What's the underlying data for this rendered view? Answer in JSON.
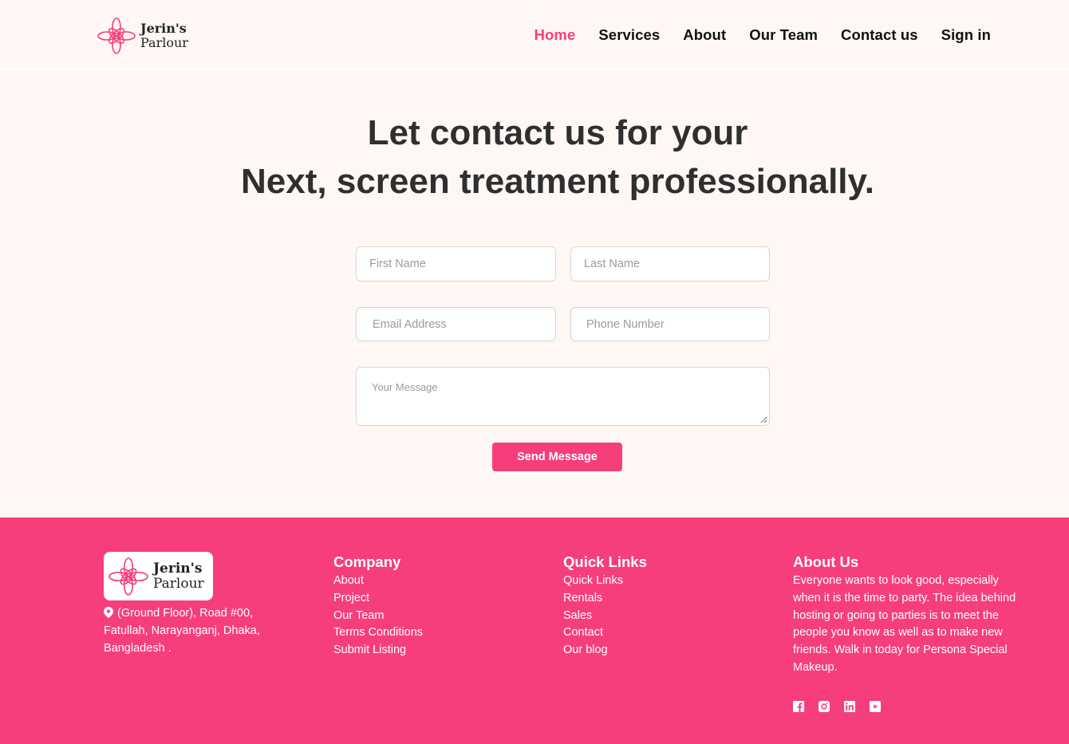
{
  "brand": {
    "name_line1": "Jerin's",
    "name_line2": "Parlour",
    "accent_color": "#f63e7b"
  },
  "nav": {
    "items": [
      "Home",
      "Services",
      "About",
      "Our Team",
      "Contact us",
      "Sign in"
    ],
    "active": "Home"
  },
  "hero": {
    "line1": "Let contact us for your",
    "line2": "Next, screen treatment professionally."
  },
  "form": {
    "first_name_placeholder": "First Name",
    "last_name_placeholder": "Last Name",
    "email_placeholder": "Email Address",
    "phone_placeholder": "Phone Number",
    "message_placeholder": "Your Message",
    "submit_label": "Send Message"
  },
  "footer": {
    "address": "(Ground Floor), Road #00, Fatullah, Narayanganj, Dhaka, Bangladesh .",
    "company": {
      "title": "Company",
      "links": [
        "About",
        "Project",
        "Our Team",
        "Terms Conditions",
        "Submit Listing"
      ]
    },
    "quick_links": {
      "title": "Quick Links",
      "links": [
        "Quick Links",
        "Rentals",
        "Sales",
        "Contact",
        "Our blog"
      ]
    },
    "about": {
      "title": "About Us",
      "text": "Everyone wants to look good, especially when it is the time to party. The idea behind hosting or going to parties is to meet the people you know as well as to make new friends. Walk in today for Persona Special Makeup."
    },
    "social_icons": [
      "facebook-icon",
      "instagram-icon",
      "linkedin-icon",
      "youtube-icon"
    ]
  }
}
